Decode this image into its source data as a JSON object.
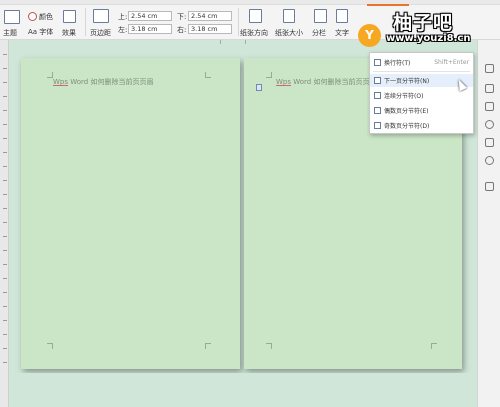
{
  "toolbar": {
    "theme_label": "主题",
    "colors_label": "颜色",
    "fonts_label": "Aa 字体",
    "effects_label": "效果",
    "margins_label": "页边距",
    "margin_top_label": "上:",
    "margin_top_value": "2.54 cm",
    "margin_bottom_label": "下:",
    "margin_bottom_value": "2.54 cm",
    "margin_left_label": "左:",
    "margin_left_value": "3.18 cm",
    "margin_right_label": "右:",
    "margin_right_value": "3.18 cm",
    "orientation_label": "纸张方向",
    "size_label": "纸张大小",
    "columns_label": "分栏",
    "text_direction_label": "文字"
  },
  "pages": {
    "left_header": {
      "prefix": "Wps",
      "rest": " Word 如何删除当前页页眉"
    },
    "right_header": {
      "prefix": "Wps",
      "rest": " Word 如何删除当前页页眉"
    }
  },
  "menu": {
    "items": [
      {
        "label": "换行符(T)",
        "shortcut": "Shift+Enter"
      },
      {
        "label": "下一页分节符(N)",
        "shortcut": ""
      },
      {
        "label": "连续分节符(O)",
        "shortcut": ""
      },
      {
        "label": "偶数页分节符(E)",
        "shortcut": ""
      },
      {
        "label": "奇数页分节符(D)",
        "shortcut": ""
      }
    ]
  },
  "watermark": {
    "badge": "Y",
    "title": "柚子吧",
    "url": "www.youzi8.cn"
  },
  "colors": {
    "accent": "#e8742f",
    "page_bg": "#cbe6c6",
    "canvas_bg": "#cfe6d8",
    "logo_badge": "#f7a823"
  }
}
